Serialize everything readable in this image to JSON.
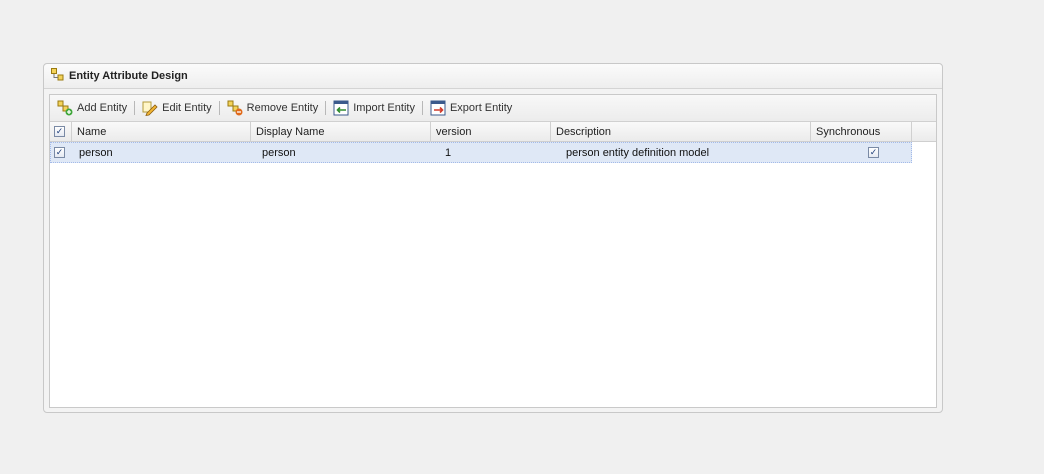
{
  "panel": {
    "title": "Entity Attribute Design"
  },
  "toolbar": {
    "add_label": "Add Entity",
    "edit_label": "Edit Entity",
    "remove_label": "Remove Entity",
    "import_label": "Import Entity",
    "export_label": "Export Entity"
  },
  "grid": {
    "columns": {
      "name": "Name",
      "display_name": "Display Name",
      "version": "version",
      "description": "Description",
      "synchronous": "Synchronous"
    },
    "rows": [
      {
        "name": "person",
        "display_name": "person",
        "version": "1",
        "description": "person entity definition model",
        "synchronous": true,
        "selected": true
      }
    ],
    "select_all_checked": true
  },
  "icons": {
    "panel": "entity-tree-icon",
    "add": "add-entity-icon",
    "edit": "edit-pencil-icon",
    "remove": "remove-entity-icon",
    "import": "import-icon",
    "export": "export-icon"
  }
}
